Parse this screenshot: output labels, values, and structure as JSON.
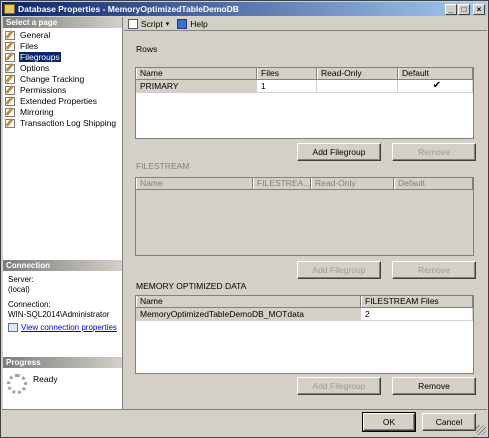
{
  "window": {
    "title": "Database Properties - MemoryOptimizedTableDemoDB",
    "controls": {
      "minimize": "_",
      "maximize": "□",
      "close": "×"
    }
  },
  "left": {
    "select_page_header": "Select a page",
    "pages": [
      {
        "label": "General",
        "selected": false
      },
      {
        "label": "Files",
        "selected": false
      },
      {
        "label": "Filegroups",
        "selected": true
      },
      {
        "label": "Options",
        "selected": false
      },
      {
        "label": "Change Tracking",
        "selected": false
      },
      {
        "label": "Permissions",
        "selected": false
      },
      {
        "label": "Extended Properties",
        "selected": false
      },
      {
        "label": "Mirroring",
        "selected": false
      },
      {
        "label": "Transaction Log Shipping",
        "selected": false
      }
    ],
    "connection_header": "Connection",
    "server_label": "Server:",
    "server_value": "(local)",
    "connection_label": "Connection:",
    "connection_value": "WIN-SQL2014\\Administrator",
    "view_props_link": "View connection properties",
    "progress_header": "Progress",
    "progress_status": "Ready"
  },
  "toolbar": {
    "script_label": "Script",
    "script_caret": "▾",
    "help_label": "Help"
  },
  "rows_section": {
    "title": "Rows",
    "columns": [
      "Name",
      "Files",
      "Read-Only",
      "Default"
    ],
    "rows": [
      {
        "name": "PRIMARY",
        "files": "1",
        "read_only": false,
        "default": true
      }
    ],
    "add_button": "Add Filegroup",
    "remove_button": "Remove"
  },
  "filestream_section": {
    "title": "FILESTREAM",
    "columns": [
      "Name",
      "FILESTREA...",
      "Read-Only",
      "Default"
    ],
    "add_button": "Add Filegroup",
    "remove_button": "Remove"
  },
  "memory_section": {
    "title": "MEMORY OPTIMIZED DATA",
    "columns": [
      "Name",
      "FILESTREAM Files"
    ],
    "rows": [
      {
        "name": "MemoryOptimizedTableDemoDB_MOTdata",
        "files": "2"
      }
    ],
    "add_button": "Add Filegroup",
    "remove_button": "Remove"
  },
  "footer": {
    "ok_button": "OK",
    "cancel_button": "Cancel"
  },
  "icons": {
    "page_icon": "wrench-icon",
    "check": "✔"
  }
}
